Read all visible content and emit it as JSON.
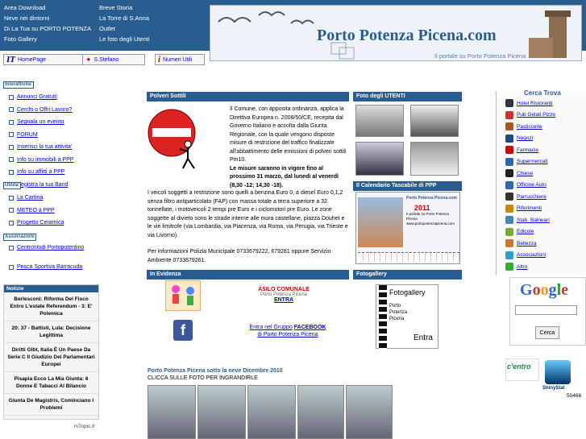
{
  "header": {
    "links_col1": [
      "Area Download",
      "Neve nei dintorni",
      "Di La Tua su PORTO POTENZA",
      "Foto Gallery"
    ],
    "links_col2": [
      "Breve Storia",
      "La Torre di S.Anna",
      "Outlet",
      "Le foto degli Utenti"
    ],
    "logo_title": "Porto Potenza Picena.com",
    "logo_subtitle": "Il portale su Porto Potenza Picena"
  },
  "lang_bar": [
    {
      "code": "IT",
      "label": "HomePage"
    },
    {
      "code": "",
      "label": "S.Stefano"
    },
    {
      "code": "i",
      "label": "Numeri Utili"
    }
  ],
  "left": {
    "interattivita_label": "Interattivita'",
    "interattivita": [
      "Annunci Gratuiti",
      "Cerchi o Offri Lavoro?",
      "Segnala un evento",
      "FORUM",
      "Inserisci la tua attivita'",
      "Info su immobili a PPP",
      "Info su affitti a PPP",
      "Registra la tua Band"
    ],
    "utilita_label": "Utilita'",
    "utilita": [
      "La Cartina",
      "METEO a PPP",
      "Progetto Ceramica"
    ],
    "associazioni_label": "Associazioni",
    "associazioni": [
      "Centrostudi Portopotentino",
      "Pesca Sportiva Barracuda"
    ],
    "notizie_label": "Notizie",
    "notizie": [
      "Berlesconi: Riforma Del Fisco Entro L'estate Referendum - 3: E' Polemica",
      "20: 37 - Battisti, Lula: Decisione Legittima",
      "Diritti Glbt, Italia È Un Paese Da Serie C Il Giudizio Dei Parlamentari Europei",
      "Pisapia Ecco La Mia Giunta: 6 Donne E Tabacci Al Bilancio",
      "Giunta De Magistris, Cominciano I Problemi"
    ],
    "intopic": "inTopic.it"
  },
  "main": {
    "polveri_title": "Polveri Sottili",
    "polveri_p1": "Il Comune, con apposita ordinanza, applica la Direttiva Europea n. 2008/50/CE, recepita dal Governo Italiano e accolta dalla Giunta Regionale, con la quale vengono disposte misure di restrizione del traffico finalizzate all'abbattimento delle emissioni di polveri sottili Pm10.",
    "polveri_bold": "Le misure saranno in vigore fino al prossimo 31 marzo, dal lunedì al venerdì (8,30 -12; 14,30 -18).",
    "polveri_p2": "I veicoli soggetti a restrizione sono quelli a benzina Euro 0, a diesel Euro 0,1,2 senza filtro antiparticolato (FAP) con massa totale a terra superiore a 32 tonnellate, i motoveicoli 2 tempi pre Euro e i ciclomotori pre Euro. Le zone soggette al divieto sono le strade interne alle mura castellane, piazza Douhet e le vie limitrofe (via Lombardia, via Piacenza, via Roma, via Perugia, via Trieste e via Livorno).",
    "polveri_p3": "Per informazioni Polizia Municipale 0733679222, 679281 oppure Servizio Ambiente 0733679261.",
    "evidenza_title": "In Evidenza",
    "asilo_title": "ASILO COMUNALE",
    "asilo_place": "Porto Potenza Picena",
    "asilo_link": "ENTRA",
    "fb_line1": "Entra nel Gruppo",
    "fb_link": "FACEBOOK",
    "fb_line2": "di Porto Potenza Picena",
    "neve_title": "Porto Potenza Picena sotto la neve Dicembre 2010",
    "neve_sub": "CLICCA SULLE FOTO PER INGRANDIRLE"
  },
  "right": {
    "foto_utenti": "Foto degli UTENTI",
    "calendario": "Il Calendario Tascabile di PPP",
    "cal_title": "Porto Potenza Picena.com",
    "cal_year": "2011",
    "cal_text": "Il portale su Porto Potenza Picena www.portopotenzapicena.com",
    "fotogallery": "Fotogallery",
    "fg_lines": [
      "Fotogallery",
      "Porto",
      "Potenza",
      "Picena",
      "Entra"
    ]
  },
  "cerca": {
    "title": "Cerca Trova",
    "items": [
      "Hotel Ristoranti",
      "Pub Gelati Pizze",
      "Pasticcerie",
      "Negozi",
      "Farmacie",
      "Supermercati",
      "Chiese",
      "Officine Auto",
      "Parrucchiere",
      "Riferimenti",
      "Stab. Balneari",
      "Edicole",
      "Bellezza",
      "Associazioni",
      "Altro"
    ],
    "colors": [
      "#334",
      "#c33",
      "#a52",
      "#248",
      "#c00",
      "#36a",
      "#222",
      "#36a",
      "#333",
      "#c80",
      "#48b",
      "#7a3",
      "#c73",
      "#39c",
      "#3a3"
    ],
    "google": "Google",
    "search_btn": "Cerca",
    "centro": "c'entro",
    "shinystat": "ShinyStat",
    "counter": "50466"
  }
}
